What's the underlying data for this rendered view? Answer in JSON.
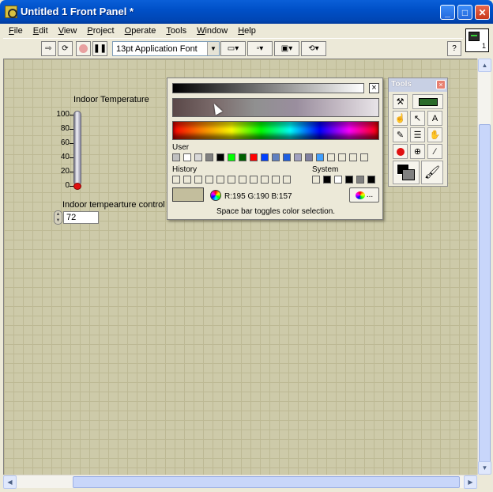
{
  "window": {
    "title": "Untitled 1 Front Panel *"
  },
  "menu": {
    "items": [
      "File",
      "Edit",
      "View",
      "Project",
      "Operate",
      "Tools",
      "Window",
      "Help"
    ]
  },
  "toolbar": {
    "font_select": "13pt Application Font",
    "help_label": "?"
  },
  "vi_icon": {
    "number": "1"
  },
  "thermometer": {
    "label": "Indoor Temperature",
    "ticks": [
      "100",
      "80",
      "60",
      "40",
      "20",
      "0"
    ],
    "value": 0
  },
  "numeric_control": {
    "label": "Indoor tempearture control",
    "value": "72"
  },
  "color_picker": {
    "user_label": "User",
    "history_label": "History",
    "system_label": "System",
    "rgb_readout": "R:195 G:190 B:157",
    "more_label": "...",
    "hint": "Space bar toggles color selection.",
    "current_color": "#c3be9d",
    "user_colors": [
      "#c0c0c0",
      "#ffffff",
      "#d8d8d8",
      "#808080",
      "#000000",
      "#00ff00",
      "#006000",
      "#ff0000",
      "#0040ff",
      "#6080c0",
      "#2060e0",
      "#a0a0c0",
      "#8080a0",
      "#40a0ff",
      "#ece9d8",
      "#ece9d8",
      "#ece9d8",
      "#ece9d8"
    ],
    "system_colors": [
      "#ece9d8",
      "#000000",
      "#ffffff",
      "#000000",
      "#808080",
      "#000000"
    ]
  },
  "tools": {
    "title": "Tools",
    "items": [
      "wrench-icon",
      "lcd-icon",
      "hand-icon",
      "arrow-icon",
      "text-icon",
      "wire-icon",
      "object-shortcut-icon",
      "scroll-icon",
      "breakpoint-icon",
      "probe-icon",
      "eyedropper-icon",
      "color-swatch-icon",
      "brush-icon"
    ]
  }
}
